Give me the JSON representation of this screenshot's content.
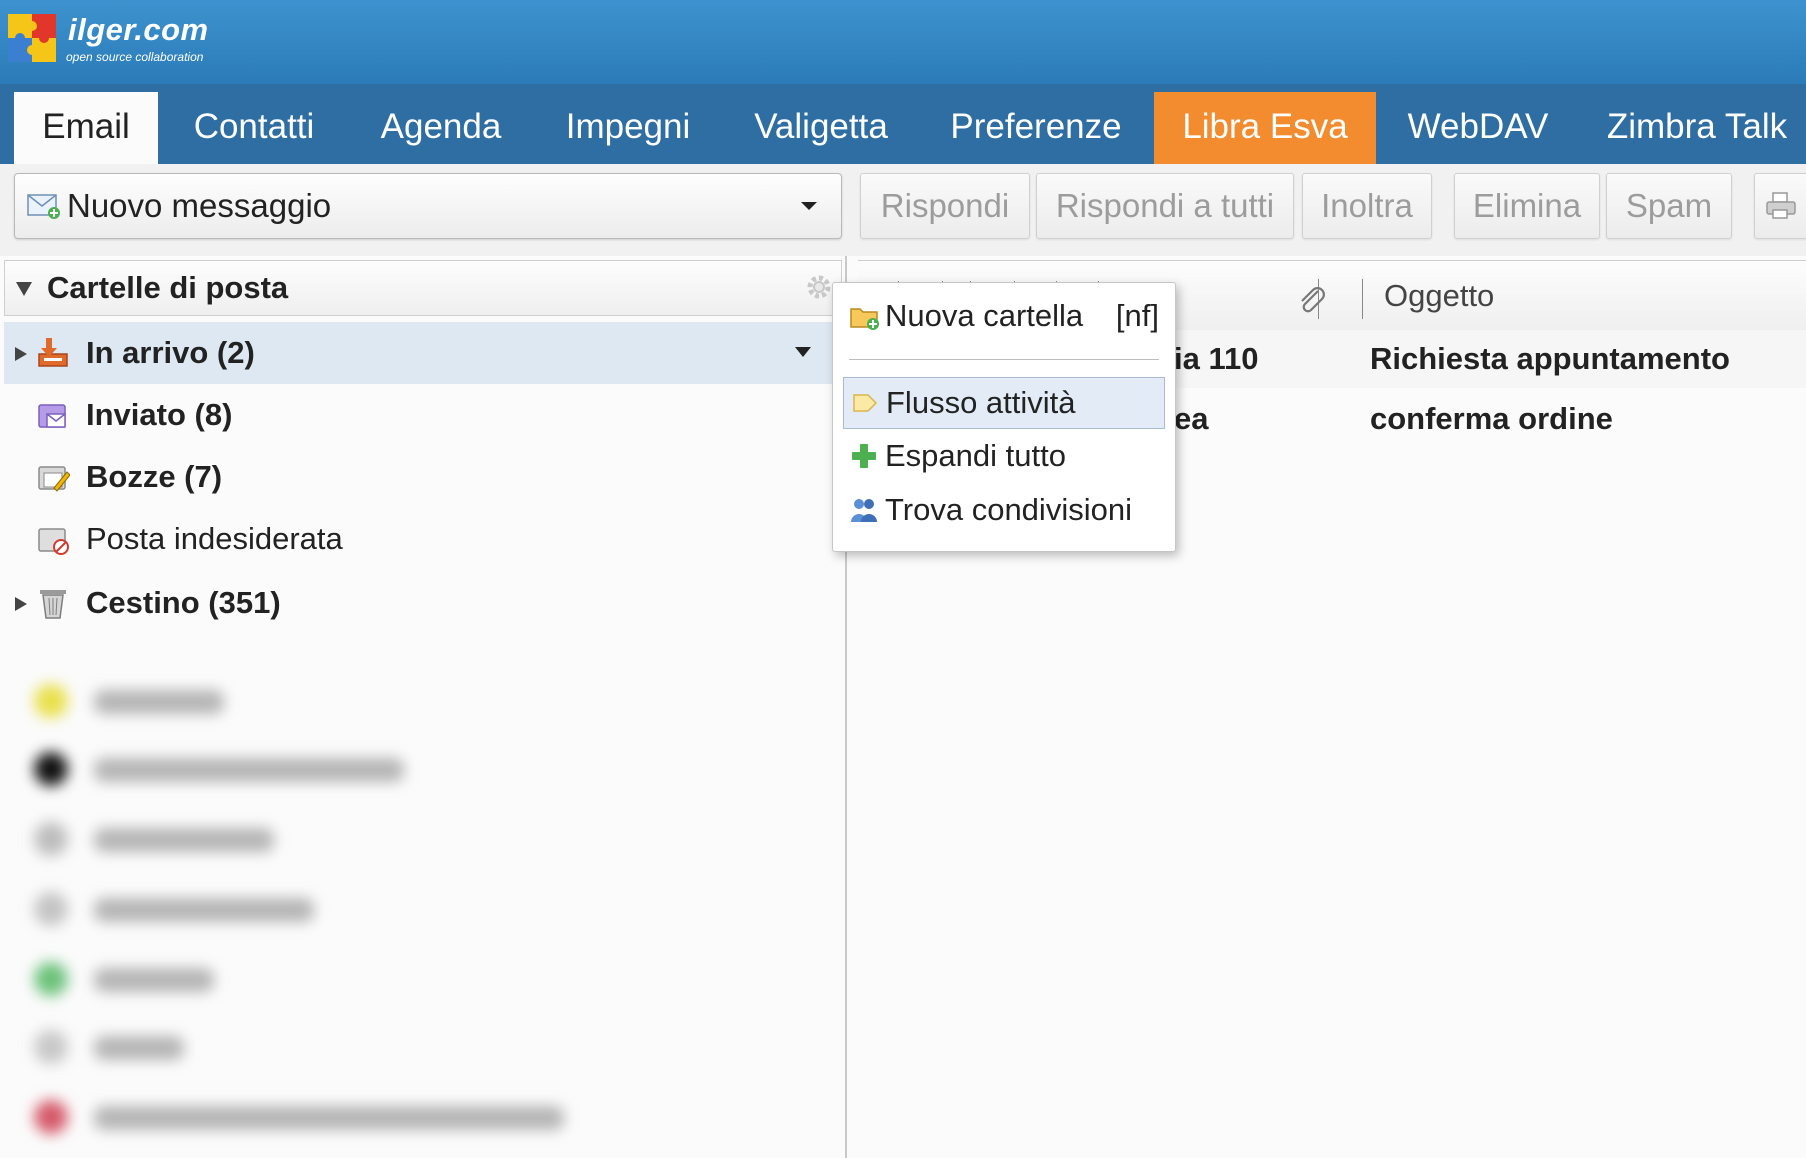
{
  "brand": {
    "name": "ilger.com",
    "tagline": "open source collaboration"
  },
  "colors": {
    "banner": "#3a8fcc",
    "tabbar": "#2f6ea3",
    "highlight_tab": "#f28c2f",
    "selected_row": "#dde8f2"
  },
  "tabs": [
    {
      "label": "Email"
    },
    {
      "label": "Contatti"
    },
    {
      "label": "Agenda"
    },
    {
      "label": "Impegni"
    },
    {
      "label": "Valigetta"
    },
    {
      "label": "Preferenze"
    },
    {
      "label": "Libra Esva"
    },
    {
      "label": "WebDAV"
    },
    {
      "label": "Zimbra Talk"
    }
  ],
  "toolbar": {
    "new_message": "Nuovo messaggio",
    "reply": "Rispondi",
    "reply_all": "Rispondi a tutti",
    "forward": "Inoltra",
    "delete": "Elimina",
    "spam": "Spam"
  },
  "folders": {
    "header": "Cartelle di posta",
    "items": [
      {
        "label": "In arrivo (2)",
        "icon": "inbox-icon"
      },
      {
        "label": "Inviato (8)",
        "icon": "sent-icon"
      },
      {
        "label": "Bozze (7)",
        "icon": "drafts-icon"
      },
      {
        "label": "Posta indesiderata",
        "icon": "junk-icon"
      },
      {
        "label": "Cestino (351)",
        "icon": "trash-icon"
      }
    ]
  },
  "message_list": {
    "subject_header": "Oggetto",
    "rows": [
      {
        "from": "ia 110",
        "subject": "Richiesta appuntamento"
      },
      {
        "from": "ea",
        "subject": "conferma ordine"
      }
    ]
  },
  "context_menu": {
    "items": [
      {
        "label": "Nuova cartella",
        "shortcut": "[nf]",
        "icon": "new-folder-icon"
      },
      {
        "label": "Flusso attività",
        "icon": "activity-stream-icon"
      },
      {
        "label": "Espandi tutto",
        "icon": "expand-all-icon"
      },
      {
        "label": "Trova condivisioni",
        "icon": "find-shares-icon"
      }
    ]
  }
}
